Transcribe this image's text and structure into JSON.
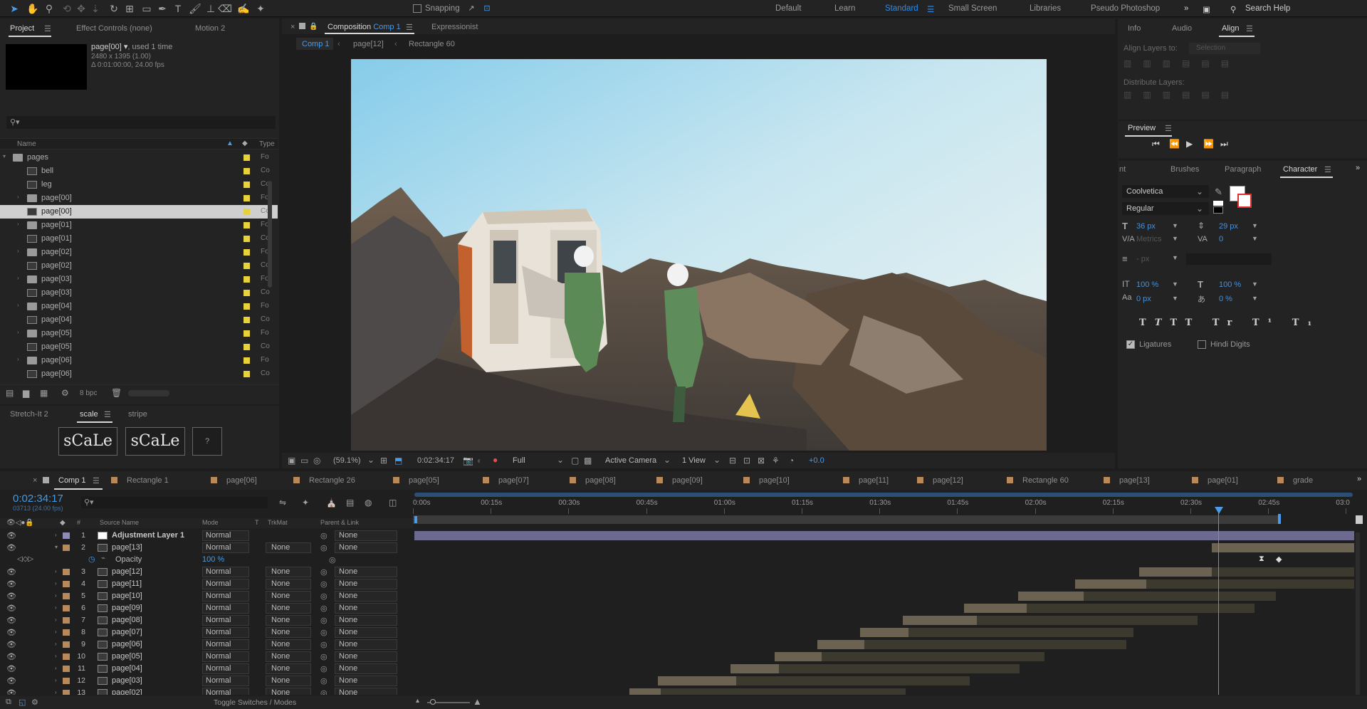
{
  "toolbar": {
    "snapping": "Snapping",
    "search": "Search Help",
    "workspaces": [
      "Default",
      "Learn",
      "Standard",
      "Small Screen",
      "Libraries",
      "Pseudo Photoshop"
    ],
    "active_workspace": "Standard"
  },
  "project": {
    "tabs": [
      "Project",
      "Effect Controls (none)",
      "Motion 2"
    ],
    "item_name": "page[00]",
    "item_used": ", used 1 time",
    "item_size": "2480 x 1395 (1.00)",
    "item_duration": "Δ 0:01:00:00, 24.00 fps",
    "search_placeholder": "",
    "col_name": "Name",
    "col_type": "Type",
    "rows": [
      {
        "name": "pages",
        "type": "Fo",
        "kind": "folder",
        "indent": 0,
        "twirl": "▾"
      },
      {
        "name": "bell",
        "type": "Co",
        "kind": "comp",
        "indent": 1,
        "twirl": ""
      },
      {
        "name": "leg",
        "type": "Co",
        "kind": "comp",
        "indent": 1,
        "twirl": ""
      },
      {
        "name": "page[00]",
        "type": "Fo",
        "kind": "folder",
        "indent": 1,
        "twirl": "›"
      },
      {
        "name": "page[00]",
        "type": "Co",
        "kind": "comp",
        "indent": 1,
        "twirl": "",
        "selected": true
      },
      {
        "name": "page[01]",
        "type": "Fo",
        "kind": "folder",
        "indent": 1,
        "twirl": "›"
      },
      {
        "name": "page[01]",
        "type": "Co",
        "kind": "comp",
        "indent": 1,
        "twirl": ""
      },
      {
        "name": "page[02]",
        "type": "Fo",
        "kind": "folder",
        "indent": 1,
        "twirl": "›"
      },
      {
        "name": "page[02]",
        "type": "Co",
        "kind": "comp",
        "indent": 1,
        "twirl": ""
      },
      {
        "name": "page[03]",
        "type": "Fo",
        "kind": "folder",
        "indent": 1,
        "twirl": "›"
      },
      {
        "name": "page[03]",
        "type": "Co",
        "kind": "comp",
        "indent": 1,
        "twirl": ""
      },
      {
        "name": "page[04]",
        "type": "Fo",
        "kind": "folder",
        "indent": 1,
        "twirl": "›"
      },
      {
        "name": "page[04]",
        "type": "Co",
        "kind": "comp",
        "indent": 1,
        "twirl": ""
      },
      {
        "name": "page[05]",
        "type": "Fo",
        "kind": "folder",
        "indent": 1,
        "twirl": "›"
      },
      {
        "name": "page[05]",
        "type": "Co",
        "kind": "comp",
        "indent": 1,
        "twirl": ""
      },
      {
        "name": "page[06]",
        "type": "Fo",
        "kind": "folder",
        "indent": 1,
        "twirl": "›"
      },
      {
        "name": "page[06]",
        "type": "Co",
        "kind": "comp",
        "indent": 1,
        "twirl": ""
      }
    ],
    "bpc": "8 bpc"
  },
  "scripts": {
    "tabs": [
      "Stretch-It 2",
      "scale",
      "stripe"
    ],
    "buttons": [
      "sCaLe",
      "sCaLe",
      "?"
    ]
  },
  "comp": {
    "panel_label": "Composition",
    "comp_name": "Comp 1",
    "expressionist": "Expressionist",
    "breadcrumbs": [
      "Comp 1",
      "page[12]",
      "Rectangle 60"
    ],
    "zoom": "(59.1%)",
    "timecode": "0:02:34:17",
    "resolution": "Full",
    "camera": "Active Camera",
    "views": "1 View",
    "exposure": "+0.0"
  },
  "right": {
    "tabs": [
      "Info",
      "Audio",
      "Align"
    ],
    "align_layers_to": "Align Layers to:",
    "selection": "Selection",
    "distribute": "Distribute Layers:",
    "preview": "Preview",
    "char_tabs": [
      "nt",
      "Brushes",
      "Paragraph",
      "Character"
    ],
    "font": "Coolvetica",
    "style": "Regular",
    "size": "36 px",
    "leading": "29 px",
    "kerning": "Metrics",
    "tracking": "0",
    "stroke": "- px",
    "vscale": "100 %",
    "hscale": "100 %",
    "baseline": "0 px",
    "tsume": "0 %",
    "ligatures": "Ligatures",
    "hindi": "Hindi Digits"
  },
  "timeline": {
    "tabs": [
      "Comp 1",
      "Rectangle 1",
      "page[06]",
      "Rectangle 26",
      "page[05]",
      "page[07]",
      "page[08]",
      "page[09]",
      "page[10]",
      "page[11]",
      "page[12]",
      "Rectangle 60",
      "page[13]",
      "page[01]",
      "grade"
    ],
    "timecode": "0:02:34:17",
    "fps": "03713 (24.00 fps)",
    "headers": {
      "num": "#",
      "source": "Source Name",
      "mode": "Mode",
      "t": "T",
      "trkmat": "TrkMat",
      "parent": "Parent & Link"
    },
    "ruler": [
      "0:00s",
      "00:15s",
      "00:30s",
      "00:45s",
      "01:00s",
      "01:15s",
      "01:30s",
      "01:45s",
      "02:00s",
      "02:15s",
      "02:30s",
      "02:45s",
      "03:0"
    ],
    "opacity_label": "Opacity",
    "opacity_value": "100 %",
    "layers": [
      {
        "num": "1",
        "name": "Adjustment Layer 1",
        "mode": "Normal",
        "trkmat": "",
        "parent": "None"
      },
      {
        "num": "2",
        "name": "page[13]",
        "mode": "Normal",
        "trkmat": "None",
        "parent": "None"
      },
      {
        "num": "3",
        "name": "page[12]",
        "mode": "Normal",
        "trkmat": "None",
        "parent": "None"
      },
      {
        "num": "4",
        "name": "page[11]",
        "mode": "Normal",
        "trkmat": "None",
        "parent": "None"
      },
      {
        "num": "5",
        "name": "page[10]",
        "mode": "Normal",
        "trkmat": "None",
        "parent": "None"
      },
      {
        "num": "6",
        "name": "page[09]",
        "mode": "Normal",
        "trkmat": "None",
        "parent": "None"
      },
      {
        "num": "7",
        "name": "page[08]",
        "mode": "Normal",
        "trkmat": "None",
        "parent": "None"
      },
      {
        "num": "8",
        "name": "page[07]",
        "mode": "Normal",
        "trkmat": "None",
        "parent": "None"
      },
      {
        "num": "9",
        "name": "page[06]",
        "mode": "Normal",
        "trkmat": "None",
        "parent": "None"
      },
      {
        "num": "10",
        "name": "page[05]",
        "mode": "Normal",
        "trkmat": "None",
        "parent": "None"
      },
      {
        "num": "11",
        "name": "page[04]",
        "mode": "Normal",
        "trkmat": "None",
        "parent": "None"
      },
      {
        "num": "12",
        "name": "page[03]",
        "mode": "Normal",
        "trkmat": "None",
        "parent": "None"
      },
      {
        "num": "13",
        "name": "page[02]",
        "mode": "Normal",
        "trkmat": "None",
        "parent": "None"
      }
    ],
    "toggle": "Toggle Switches / Modes"
  }
}
